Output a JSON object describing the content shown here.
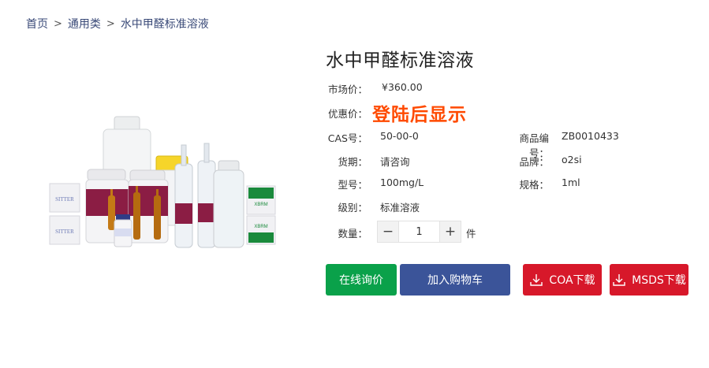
{
  "breadcrumb": {
    "home": "首页",
    "sep": ">",
    "category": "通用类",
    "current": "水中甲醛标准溶液"
  },
  "product": {
    "title": "水中甲醛标准溶液",
    "market_price_label": "市场价：",
    "market_price": "¥360.00",
    "promo_label": "优惠价：",
    "promo_text": "登陆后显示",
    "fields": {
      "cas_label": "CAS号：",
      "cas": "50-00-0",
      "code_label": "商品编号：",
      "code": "ZB0010433",
      "delivery_label": "货期：",
      "delivery": "请咨询",
      "brand_label": "品牌：",
      "brand": "o2si",
      "model_label": "型号：",
      "model": "100mg/L",
      "spec_label": "规格：",
      "spec": "1ml",
      "grade_label": "级别：",
      "grade": "标准溶液"
    },
    "quantity_label": "数量：",
    "quantity": "1",
    "minus": "−",
    "plus": "+",
    "unit": "件"
  },
  "actions": {
    "inquiry": "在线询价",
    "add_cart": "加入购物车",
    "coa": "COA下载",
    "msds": "MSDS下载"
  },
  "colors": {
    "accent_red": "#d7182a",
    "promo_orange": "#ff4a00",
    "inquiry_green": "#0aa14a",
    "cart_blue": "#3b5499"
  },
  "image": {
    "box_text": "SITTER",
    "logo_text": "XBRM"
  }
}
